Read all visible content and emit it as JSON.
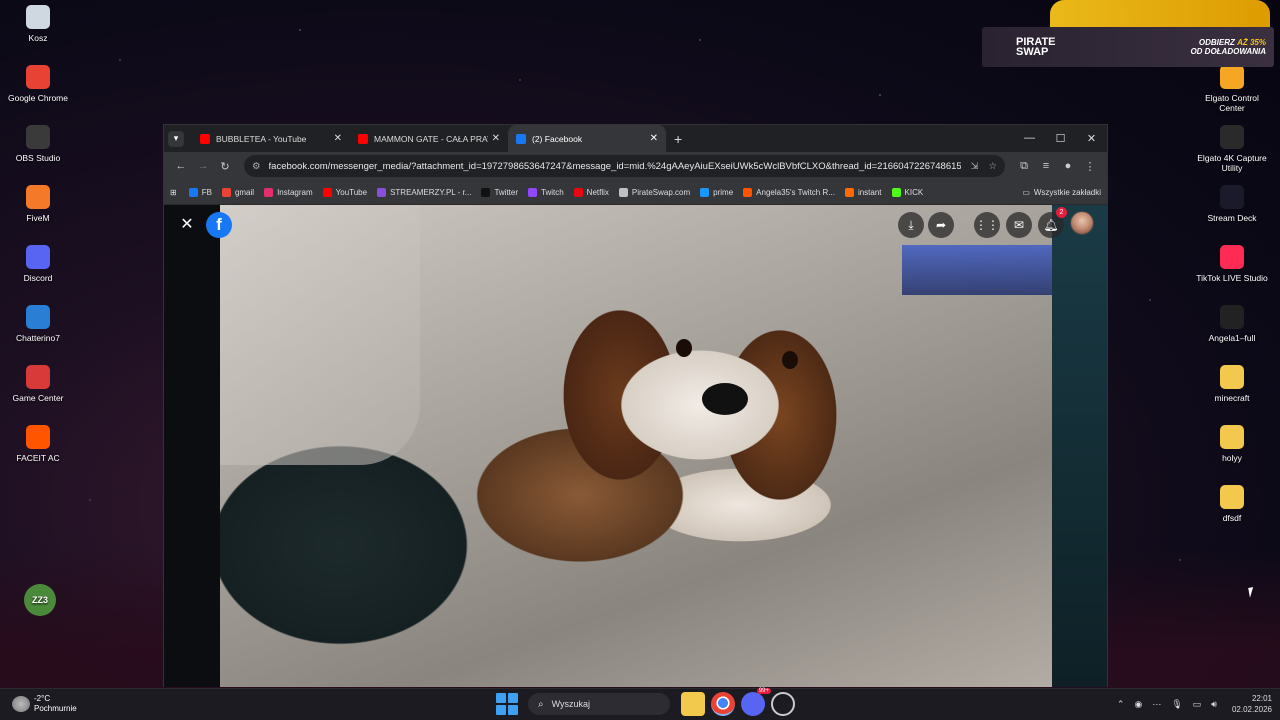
{
  "desktop": {
    "left_icons": [
      {
        "label": "Kosz",
        "icon": "recycle-bin-icon",
        "color": "#cfd8e0"
      },
      {
        "label": "Google Chrome",
        "icon": "chrome-icon",
        "color": "#e84235"
      },
      {
        "label": "OBS Studio",
        "icon": "obs-icon",
        "color": "#3a3a3a"
      },
      {
        "label": "FiveM",
        "icon": "fivem-icon",
        "color": "#f47a2a"
      },
      {
        "label": "Discord",
        "icon": "discord-icon",
        "color": "#5865f2"
      },
      {
        "label": "Chatterino7",
        "icon": "chatterino-icon",
        "color": "#2a7fd4"
      },
      {
        "label": "Game Center",
        "icon": "game-center-icon",
        "color": "#d83a3a"
      },
      {
        "label": "FACEIT AC",
        "icon": "faceit-icon",
        "color": "#ff5500"
      }
    ],
    "frog_icon_text": "ZZ3",
    "right_icons": [
      {
        "label": "Elgato Control Center",
        "icon": "elgato-icon",
        "color": "#f5a623"
      },
      {
        "label": "Elgato 4K Capture Utility",
        "icon": "elgato-4k-icon",
        "color": "#2a2a2a"
      },
      {
        "label": "Stream Deck",
        "icon": "stream-deck-icon",
        "color": "#1a1a2a"
      },
      {
        "label": "TikTok LIVE Studio",
        "icon": "tiktok-icon",
        "color": "#fe2c55"
      },
      {
        "label": "Angela1–full",
        "icon": "file-icon",
        "color": "#222222"
      },
      {
        "label": "minecraft",
        "icon": "folder-icon",
        "color": "#f2c94c"
      },
      {
        "label": "holyy",
        "icon": "folder-icon",
        "color": "#f2c94c"
      },
      {
        "label": "dfsdf",
        "icon": "folder-icon",
        "color": "#f2c94c"
      }
    ]
  },
  "ad": {
    "brand_line1": "PIRATE",
    "brand_line2": "SWAP",
    "promo_line1_a": "ODBIERZ",
    "promo_line1_b": "AŻ 35%",
    "promo_line2": "OD DOŁADOWANIA"
  },
  "browser": {
    "tabs": [
      {
        "title": "BUBBLETEA - YouTube",
        "favicon_color": "#ff0000",
        "active": false
      },
      {
        "title": "MAMMON GATE - CAŁA PRAWDA",
        "favicon_color": "#ff0000",
        "active": false
      },
      {
        "title": "(2) Facebook",
        "favicon_color": "#1877f2",
        "active": true
      }
    ],
    "url": "facebook.com/messenger_media/?attachment_id=1972798653647247&message_id=mid.%24gAAeyAiuEXseiUWk5cWclBVbfCLXO&thread_id=2166047226748615",
    "bookmarks": [
      {
        "label": "FB",
        "color": "#1877f2"
      },
      {
        "label": "gmail",
        "color": "#ea4335"
      },
      {
        "label": "Instagram",
        "color": "#e1306c"
      },
      {
        "label": "YouTube",
        "color": "#ff0000"
      },
      {
        "label": "STREAMERZY.PL - r...",
        "color": "#8a4fd8"
      },
      {
        "label": "Twitter",
        "color": "#111111"
      },
      {
        "label": "Twitch",
        "color": "#9146ff"
      },
      {
        "label": "Netflix",
        "color": "#e50914"
      },
      {
        "label": "PirateSwap.com",
        "color": "#c0c0c0"
      },
      {
        "label": "prime",
        "color": "#1a98ff"
      },
      {
        "label": "Angela35's Twitch R...",
        "color": "#ff5500"
      },
      {
        "label": "instant",
        "color": "#ff6a00"
      },
      {
        "label": "KICK",
        "color": "#53fc18"
      }
    ],
    "all_bookmarks": "Wszystkie zakładki"
  },
  "viewer": {
    "notification_count": "2",
    "accent": "#1877f2"
  },
  "taskbar": {
    "temperature": "-2°C",
    "condition": "Pochmurnie",
    "search_placeholder": "Wyszukaj",
    "discord_badge": "99+",
    "time": "22:01",
    "date": "02.02.2026"
  }
}
